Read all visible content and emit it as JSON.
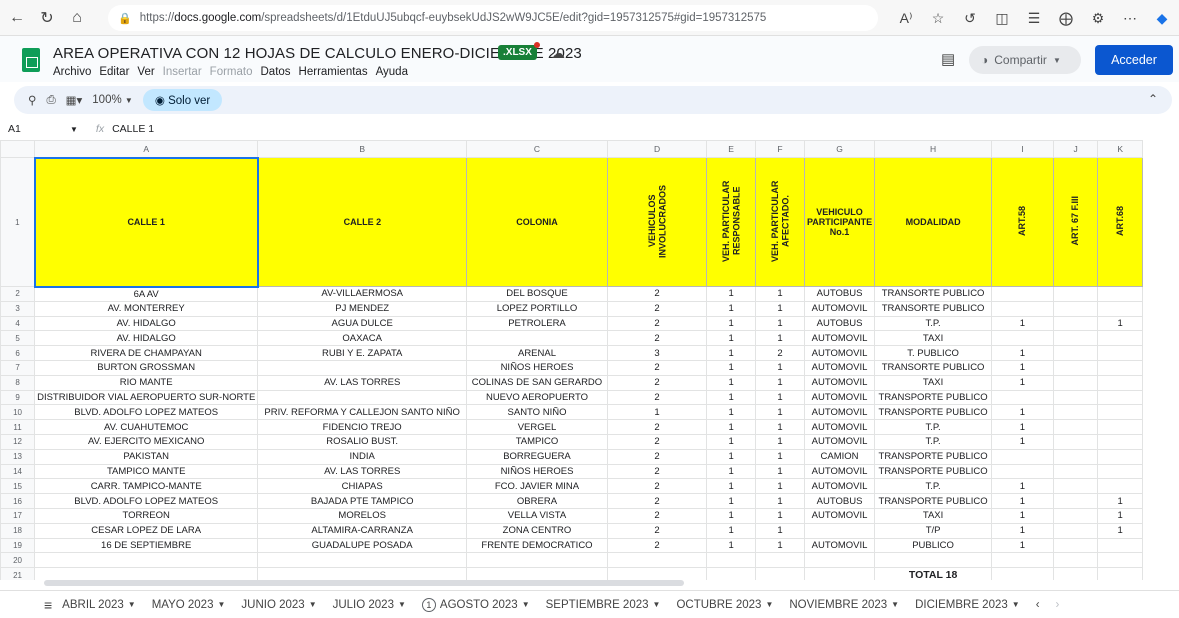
{
  "browser": {
    "url_prefix": "https://",
    "url_host": "docs.google.com",
    "url_path": "/spreadsheets/d/1EtduUJ5ubqcf-euybsekUdJS2wW9JC5E/edit?gid=1957312575#gid=1957312575",
    "read_aloud_label": "A⁾"
  },
  "doc": {
    "title": "AREA OPERATIVA CON 12 HOJAS DE CALCULO ENERO-DICIEMBRE 2023",
    "badge": ".XLSX",
    "share_label": "Compartir",
    "signin_label": "Acceder"
  },
  "menu": {
    "archivo": "Archivo",
    "editar": "Editar",
    "ver": "Ver",
    "insertar": "Insertar",
    "formato": "Formato",
    "datos": "Datos",
    "herramientas": "Herramientas",
    "ayuda": "Ayuda"
  },
  "toolbar": {
    "zoom": "100%",
    "view_only": "Solo ver"
  },
  "formula": {
    "cell_ref": "A1",
    "fx": "fx",
    "content": "CALLE 1"
  },
  "columns": [
    "A",
    "B",
    "C",
    "D",
    "E",
    "F",
    "G",
    "H",
    "I",
    "J",
    "K"
  ],
  "headers": [
    "CALLE 1",
    "CALLE 2",
    "COLONIA",
    "VEHICULOS INVOLUCRADOS",
    "VEH. PARTICULAR RESPONSABLE",
    "VEH. PARTICULAR AFECTADO.",
    "VEHICULO PARTICIPANTE No.1",
    "MODALIDAD",
    "ART.58",
    "ART. 67 F.III",
    "ART.68"
  ],
  "rows": [
    {
      "n": "2",
      "c": [
        "6A AV",
        "AV-VILLAERMOSA",
        "DEL BOSQUE",
        "2",
        "1",
        "1",
        "AUTOBUS",
        "TRANSORTE PUBLICO",
        "",
        "",
        ""
      ]
    },
    {
      "n": "3",
      "c": [
        "AV. MONTERREY",
        "PJ MENDEZ",
        "LOPEZ PORTILLO",
        "2",
        "1",
        "1",
        "AUTOMOVIL",
        "TRANSORTE PUBLICO",
        "",
        "",
        ""
      ]
    },
    {
      "n": "4",
      "c": [
        "AV. HIDALGO",
        "AGUA DULCE",
        "PETROLERA",
        "2",
        "1",
        "1",
        "AUTOBUS",
        "T.P.",
        "1",
        "",
        "1"
      ]
    },
    {
      "n": "5",
      "c": [
        "AV. HIDALGO",
        "OAXACA",
        "",
        "2",
        "1",
        "1",
        "AUTOMOVIL",
        "TAXI",
        "",
        "",
        ""
      ]
    },
    {
      "n": "6",
      "c": [
        "RIVERA DE CHAMPAYAN",
        "RUBI Y E. ZAPATA",
        "ARENAL",
        "3",
        "1",
        "2",
        "AUTOMOVIL",
        "T. PUBLICO",
        "1",
        "",
        ""
      ]
    },
    {
      "n": "7",
      "c": [
        "BURTON GROSSMAN",
        "",
        "NIÑOS HEROES",
        "2",
        "1",
        "1",
        "AUTOMOVIL",
        "TRANSORTE PUBLICO",
        "1",
        "",
        ""
      ]
    },
    {
      "n": "8",
      "c": [
        "RIO MANTE",
        "AV. LAS TORRES",
        "COLINAS DE SAN GERARDO",
        "2",
        "1",
        "1",
        "AUTOMOVIL",
        "TAXI",
        "1",
        "",
        ""
      ]
    },
    {
      "n": "9",
      "c": [
        "DISTRIBUIDOR VIAL AEROPUERTO SUR-NORTE",
        "",
        "NUEVO AEROPUERTO",
        "2",
        "1",
        "1",
        "AUTOMOVIL",
        "TRANSPORTE PUBLICO",
        "",
        "",
        ""
      ]
    },
    {
      "n": "10",
      "c": [
        "BLVD. ADOLFO LOPEZ MATEOS",
        "PRIV. REFORMA Y CALLEJON SANTO NIÑO",
        "SANTO NIÑO",
        "1",
        "1",
        "1",
        "AUTOMOVIL",
        "TRANSPORTE PUBLICO",
        "1",
        "",
        ""
      ]
    },
    {
      "n": "11",
      "c": [
        "AV. CUAHUTEMOC",
        "FIDENCIO TREJO",
        "VERGEL",
        "2",
        "1",
        "1",
        "AUTOMOVIL",
        "T.P.",
        "1",
        "",
        ""
      ]
    },
    {
      "n": "12",
      "c": [
        "AV. EJERCITO MEXICANO",
        "ROSALIO BUST.",
        "TAMPICO",
        "2",
        "1",
        "1",
        "AUTOMOVIL",
        "T.P.",
        "1",
        "",
        ""
      ]
    },
    {
      "n": "13",
      "c": [
        "PAKISTAN",
        "INDIA",
        "BORREGUERA",
        "2",
        "1",
        "1",
        "CAMION",
        "TRANSPORTE PUBLICO",
        "",
        "",
        ""
      ]
    },
    {
      "n": "14",
      "c": [
        "TAMPICO MANTE",
        "AV. LAS TORRES",
        "NIÑOS HEROES",
        "2",
        "1",
        "1",
        "AUTOMOVIL",
        "TRANSPORTE PUBLICO",
        "",
        "",
        ""
      ]
    },
    {
      "n": "15",
      "c": [
        "CARR. TAMPICO-MANTE",
        "CHIAPAS",
        "FCO. JAVIER MINA",
        "2",
        "1",
        "1",
        "AUTOMOVIL",
        "T.P.",
        "1",
        "",
        ""
      ]
    },
    {
      "n": "16",
      "c": [
        "BLVD. ADOLFO LOPEZ MATEOS",
        "BAJADA PTE TAMPICO",
        "OBRERA",
        "2",
        "1",
        "1",
        "AUTOBUS",
        "TRANSPORTE PUBLICO",
        "1",
        "",
        "1"
      ]
    },
    {
      "n": "17",
      "c": [
        "TORREON",
        "MORELOS",
        "VELLA VISTA",
        "2",
        "1",
        "1",
        "AUTOMOVIL",
        "TAXI",
        "1",
        "",
        "1"
      ]
    },
    {
      "n": "18",
      "c": [
        "CESAR LOPEZ DE LARA",
        "ALTAMIRA-CARRANZA",
        "ZONA CENTRO",
        "2",
        "1",
        "1",
        "",
        "T/P",
        "1",
        "",
        "1"
      ]
    },
    {
      "n": "19",
      "c": [
        "16 DE SEPTIEMBRE",
        "GUADALUPE POSADA",
        "FRENTE DEMOCRATICO",
        "2",
        "1",
        "1",
        "AUTOMOVIL",
        "PUBLICO",
        "1",
        "",
        ""
      ]
    },
    {
      "n": "20",
      "c": [
        "",
        "",
        "",
        "",
        "",
        "",
        "",
        "",
        "",
        "",
        ""
      ]
    },
    {
      "n": "21",
      "c": [
        "",
        "",
        "",
        "",
        "",
        "",
        "",
        "TOTAL 18",
        "",
        "",
        ""
      ]
    }
  ],
  "sheet_tabs": [
    "ABRIL 2023",
    "MAYO 2023",
    "JUNIO 2023",
    "JULIO 2023",
    "AGOSTO 2023",
    "SEPTIEMBRE 2023",
    "OCTUBRE 2023",
    "NOVIEMBRE 2023",
    "DICIEMBRE 2023"
  ],
  "active_tab_count": "1"
}
